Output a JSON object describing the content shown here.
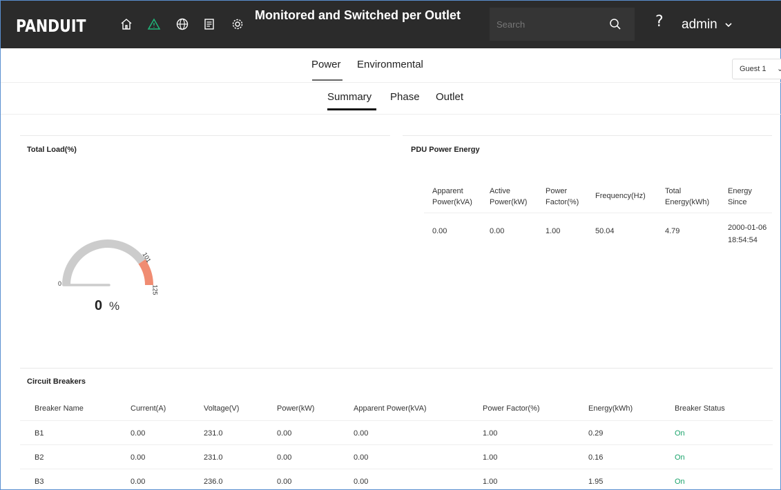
{
  "header": {
    "logo": "PANDUIT",
    "title": "Monitored and Switched per Outlet",
    "search_placeholder": "Search",
    "user": "admin",
    "icons": [
      "home-icon",
      "alarm-triangle-icon",
      "globe-icon",
      "log-icon",
      "settings-gear-icon",
      "search-icon",
      "help-icon",
      "chevron-down-icon"
    ]
  },
  "tabs": {
    "primary": [
      "Power",
      "Environmental"
    ],
    "active_primary": "Power",
    "secondary": [
      "Summary",
      "Phase",
      "Outlet"
    ],
    "active_secondary": "Summary",
    "guest_select": "Guest 1"
  },
  "total_load": {
    "title": "Total Load(%)",
    "gauge_min": "0",
    "gauge_warn": "101",
    "gauge_max": "125",
    "value": "0",
    "unit": "%",
    "colors": {
      "track": "#cccccc",
      "warn": "#f08c72"
    }
  },
  "pdu_energy": {
    "title": "PDU Power Energy",
    "headers": [
      [
        "Apparent",
        "Power(kVA)"
      ],
      [
        "Active",
        "Power(kW)"
      ],
      [
        "Power",
        "Factor(%)"
      ],
      [
        "Frequency(Hz)",
        ""
      ],
      [
        "Total",
        "Energy(kWh)"
      ],
      [
        "Energy",
        "Since"
      ]
    ],
    "values": [
      "0.00",
      "0.00",
      "1.00",
      "50.04",
      "4.79"
    ],
    "since": [
      "2000-01-06",
      "18:54:54"
    ]
  },
  "breakers": {
    "title": "Circuit Breakers",
    "headers": [
      "Breaker Name",
      "Current(A)",
      "Voltage(V)",
      "Power(kW)",
      "Apparent Power(kVA)",
      "Power Factor(%)",
      "Energy(kWh)",
      "Breaker Status"
    ],
    "rows": [
      [
        "B1",
        "0.00",
        "231.0",
        "0.00",
        "0.00",
        "1.00",
        "0.29",
        "On"
      ],
      [
        "B2",
        "0.00",
        "231.0",
        "0.00",
        "0.00",
        "1.00",
        "0.16",
        "On"
      ],
      [
        "B3",
        "0.00",
        "236.0",
        "0.00",
        "0.00",
        "1.00",
        "1.95",
        "On"
      ]
    ],
    "status_color": "#1aa36b"
  }
}
